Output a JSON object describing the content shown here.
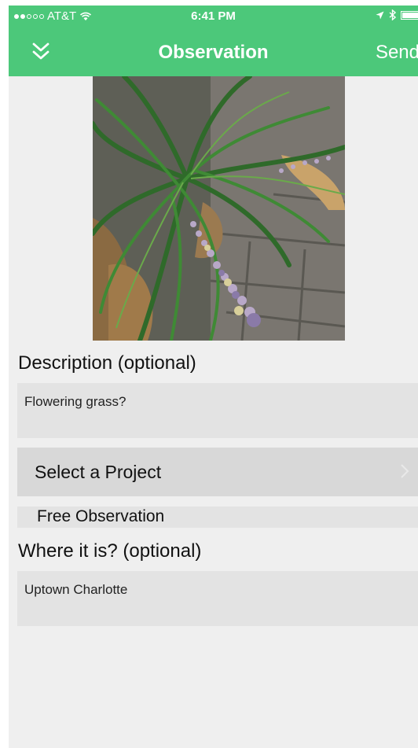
{
  "status_bar": {
    "carrier": "AT&T",
    "time": "6:41 PM"
  },
  "nav": {
    "title": "Observation",
    "send_label": "Send"
  },
  "form": {
    "description_label": "Description (optional)",
    "description_value": "Flowering grass?",
    "project_selector_label": "Select a Project",
    "selected_project": "Free Observation",
    "location_label": "Where it is? (optional)",
    "location_value": "Uptown Charlotte"
  },
  "colors": {
    "accent": "#4cc87a",
    "background": "#efefef",
    "field_background": "#e3e3e3"
  },
  "icons": {
    "collapse": "double-chevron-down-icon",
    "wifi": "wifi-icon",
    "location": "location-arrow-icon",
    "bluetooth": "bluetooth-icon",
    "battery": "battery-icon",
    "disclosure": "chevron-right-icon"
  }
}
